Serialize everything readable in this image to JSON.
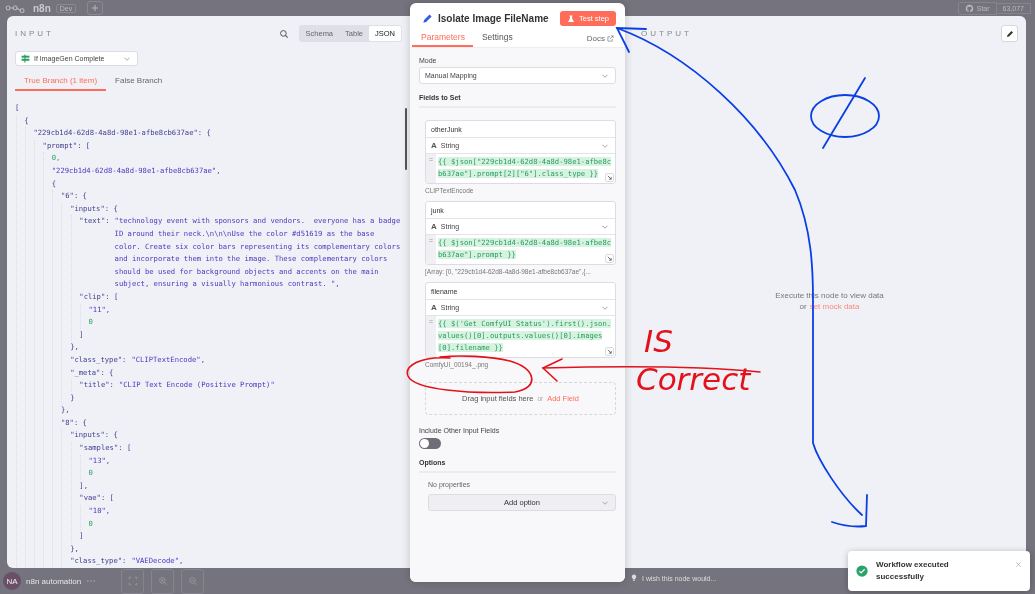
{
  "top_bar": {
    "logo_text": "n8n",
    "tag": "Dev",
    "star_label": "Star",
    "star_count": "63,077"
  },
  "input_panel": {
    "title": "INPUT",
    "view_modes": [
      {
        "label": "Schema",
        "selected": false
      },
      {
        "label": "Table",
        "selected": false
      },
      {
        "label": "JSON",
        "selected": true
      }
    ],
    "source_node": "If ImageGen Complete",
    "branches": [
      {
        "label": "True Branch (1 item)",
        "selected": true
      },
      {
        "label": "False Branch",
        "selected": false
      }
    ],
    "json_tree": [
      {
        "open": "[",
        "children": [
          {
            "open": "{",
            "children": [
              {
                "open": "\"229cb1d4-62d8-4a8d-98e1-afbe8cb637ae\": {",
                "children": [
                  {
                    "open": "\"prompt\": [",
                    "children": [
                      {
                        "kind": "number",
                        "text": "0,"
                      },
                      {
                        "kind": "string",
                        "text": "\"229cb1d4-62d8-4a8d-98e1-afbe8cb637ae\","
                      },
                      {
                        "open": "{",
                        "children": [
                          {
                            "open": "\"6\": {",
                            "children": [
                              {
                                "open": "\"inputs\": {",
                                "children": [
                                  {
                                    "kind": "string",
                                    "key": "\"text\":",
                                    "text": "\"technology event with sponsors and vendors.  everyone has a badge ID around their neck.\\n\\n\\nUse the color #d51619 as the base color. Create six color bars representing its complementary colors and incorporate them into the image. These complementary colors should be used for background objects and accents on the main subject, ensuring a visually harmonious contrast. \","
                                  },
                                  {
                                    "open": "\"clip\": [",
                                    "children": [
                                      {
                                        "kind": "string",
                                        "text": "\"11\","
                                      },
                                      {
                                        "kind": "number",
                                        "text": "0"
                                      }
                                    ],
                                    "close": "]"
                                  }
                                ],
                                "close": "},"
                              },
                              {
                                "kind": "string",
                                "key": "\"class_type\":",
                                "text": "\"CLIPTextEncode\","
                              },
                              {
                                "open": "\"_meta\": {",
                                "children": [
                                  {
                                    "kind": "string",
                                    "key": "\"title\":",
                                    "text": "\"CLIP Text Encode (Positive Prompt)\""
                                  }
                                ],
                                "close": "}"
                              }
                            ],
                            "close": "},"
                          },
                          {
                            "open": "\"8\": {",
                            "children": [
                              {
                                "open": "\"inputs\": {",
                                "children": [
                                  {
                                    "open": "\"samples\": [",
                                    "children": [
                                      {
                                        "kind": "string",
                                        "text": "\"13\","
                                      },
                                      {
                                        "kind": "number",
                                        "text": "0"
                                      }
                                    ],
                                    "close": "],"
                                  },
                                  {
                                    "open": "\"vae\": [",
                                    "children": [
                                      {
                                        "kind": "string",
                                        "text": "\"10\","
                                      },
                                      {
                                        "kind": "number",
                                        "text": "0"
                                      }
                                    ],
                                    "close": "]"
                                  }
                                ],
                                "close": "},"
                              },
                              {
                                "kind": "string",
                                "key": "\"class_type\":",
                                "text": "\"VAEDecode\","
                              }
                            ]
                          }
                        ]
                      }
                    ]
                  }
                ]
              }
            ]
          }
        ]
      }
    ]
  },
  "node_panel": {
    "title": "Isolate Image FileName",
    "test_button": "Test step",
    "tabs": [
      {
        "label": "Parameters",
        "selected": true
      },
      {
        "label": "Settings",
        "selected": false
      }
    ],
    "docs_link": "Docs",
    "mode_label": "Mode",
    "mode_value": "Manual Mapping",
    "fields_heading": "Fields to Set",
    "fields": [
      {
        "name": "otherJunk",
        "type_icon": "A",
        "type": "String",
        "expr_marker": "=",
        "expression": "{{ $json[\"229cb1d4-62d8-4a8d-98e1-afbe8cb637ae\"].prompt[2][\"6\"].class_type }}",
        "result": "CLIPTextEncode"
      },
      {
        "name": "junk",
        "type_icon": "A",
        "type": "String",
        "expr_marker": "=",
        "expression": "{{ $json[\"229cb1d4-62d8-4a8d-98e1-afbe8cb637ae\"].prompt }}",
        "result": "[Array: [0, \"229cb1d4-62d8-4a8d-98e1-afbe8cb637ae\",{..."
      },
      {
        "name": "filename",
        "type_icon": "A",
        "type": "String",
        "expr_marker": "=",
        "expression": "{{ $('Get ComfyUI Status').first().json.values()[0].outputs.values()[0].images[0].filename }}",
        "result": "ComfyUI_00194_.png"
      }
    ],
    "drop_hint": "Drag input fields here",
    "drop_or": "or",
    "add_field": "Add Field",
    "include_other": {
      "label": "Include Other Input Fields",
      "on": false
    },
    "options_heading": "Options",
    "no_properties": "No properties",
    "add_option": "Add option"
  },
  "output_panel": {
    "title": "OUTPUT",
    "empty_text": "Execute this node to view data",
    "empty_or": "or",
    "mock_link": "set mock data"
  },
  "bottom_bar": {
    "avatar_initials": "NA",
    "workflow_name": "n8n automation",
    "feedback": "I wish this node would..."
  },
  "toast": {
    "message": "Workflow executed successfully"
  },
  "annotations": {
    "note_lines": [
      "IS",
      "Correct"
    ]
  }
}
